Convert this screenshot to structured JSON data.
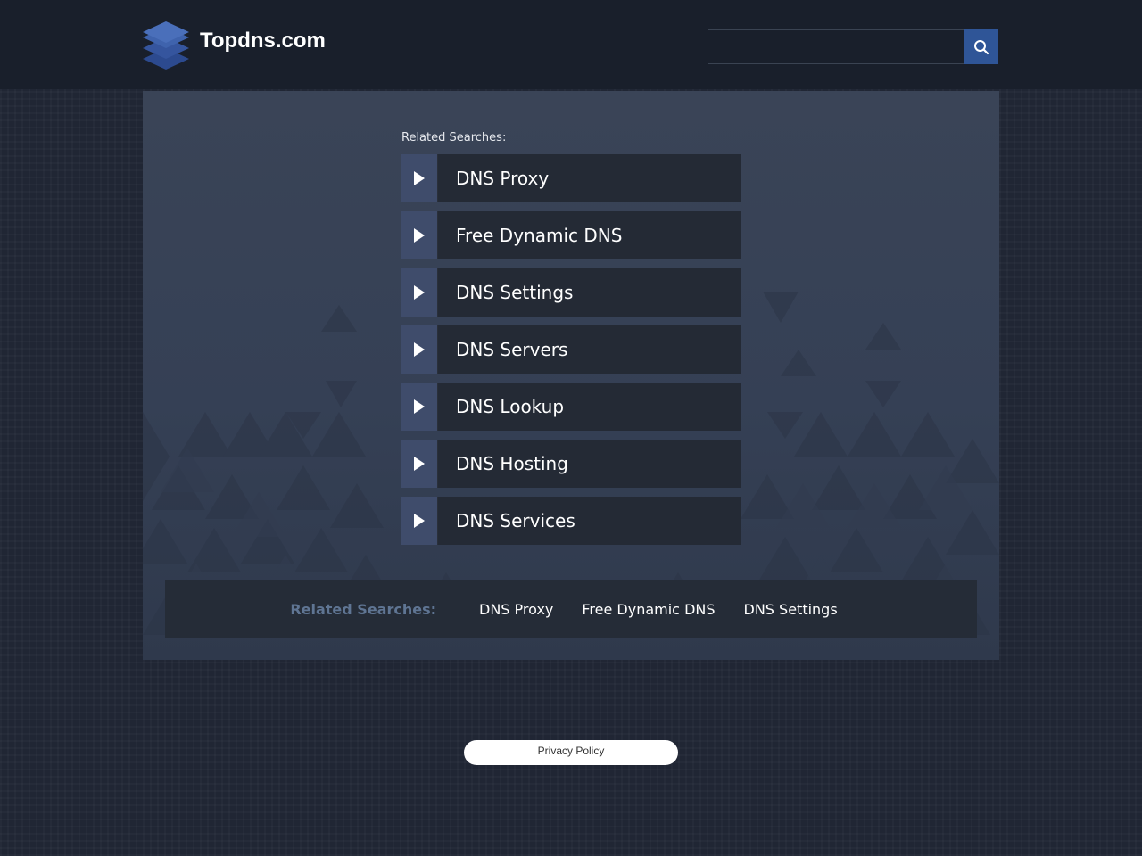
{
  "header": {
    "logo_text": "Topdns.com",
    "logo_icon": "stacked-layers-icon",
    "search": {
      "placeholder": "",
      "value": "",
      "button_icon": "search-icon"
    }
  },
  "main": {
    "related_label": "Related Searches:",
    "links": [
      {
        "label": "DNS Proxy",
        "icon": "play-arrow-icon"
      },
      {
        "label": "Free Dynamic DNS",
        "icon": "play-arrow-icon"
      },
      {
        "label": "DNS Settings",
        "icon": "play-arrow-icon"
      },
      {
        "label": "DNS Servers",
        "icon": "play-arrow-icon"
      },
      {
        "label": "DNS Lookup",
        "icon": "play-arrow-icon"
      },
      {
        "label": "DNS Hosting",
        "icon": "play-arrow-icon"
      },
      {
        "label": "DNS Services",
        "icon": "play-arrow-icon"
      }
    ]
  },
  "bottom_bar": {
    "label": "Related Searches:",
    "links": [
      "DNS Proxy",
      "Free Dynamic DNS",
      "DNS Settings"
    ]
  },
  "footer": {
    "privacy_label": "Privacy Policy"
  },
  "colors": {
    "header_bg": "#191f2b",
    "page_bg": "#202634",
    "panel_bg": "#3a4457",
    "accent": "#2f5597",
    "arrow_box": "#3f4c6b",
    "link_box": "#242a35",
    "bottom_label": "#5f7593"
  }
}
